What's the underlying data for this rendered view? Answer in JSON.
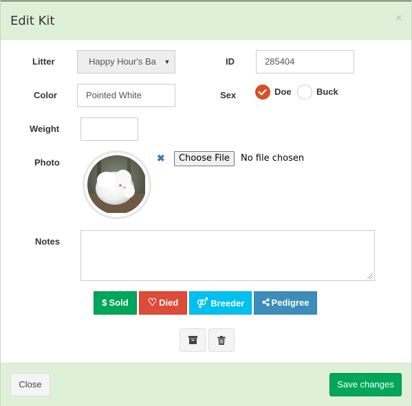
{
  "modal": {
    "title": "Edit Kit",
    "close_glyph": "×"
  },
  "form": {
    "litter": {
      "label": "Litter",
      "value": "Happy Hour's Ba",
      "caret": "▼"
    },
    "id": {
      "label": "ID",
      "value": "285404"
    },
    "color": {
      "label": "Color",
      "value": "Pointed White"
    },
    "sex": {
      "label": "Sex",
      "options": [
        "Doe",
        "Buck"
      ],
      "selected": "Doe"
    },
    "weight": {
      "label": "Weight",
      "value": ""
    },
    "photo": {
      "label": "Photo",
      "remove_glyph": "✖",
      "file_button": "Choose File",
      "file_status": "No file chosen"
    },
    "notes": {
      "label": "Notes",
      "value": ""
    }
  },
  "actions": {
    "sold": {
      "label": "Sold",
      "icon": "dollar-icon",
      "glyph": "$"
    },
    "died": {
      "label": "Died",
      "icon": "heart-icon",
      "glyph": "♡"
    },
    "breeder": {
      "label": "Breeder",
      "icon": "gender-icon",
      "glyph": "⚤"
    },
    "pedigree": {
      "label": "Pedigree",
      "icon": "share-icon"
    },
    "archive": {
      "icon": "archive-icon"
    },
    "delete": {
      "icon": "trash-icon"
    }
  },
  "footer": {
    "close_label": "Close",
    "save_label": "Save changes"
  },
  "colors": {
    "header_bg": "#dff0d8",
    "success": "#00a65a",
    "danger": "#dd4b39",
    "info": "#00c0ef",
    "primary": "#3c8dbc",
    "radio_checked": "#d2522a"
  }
}
